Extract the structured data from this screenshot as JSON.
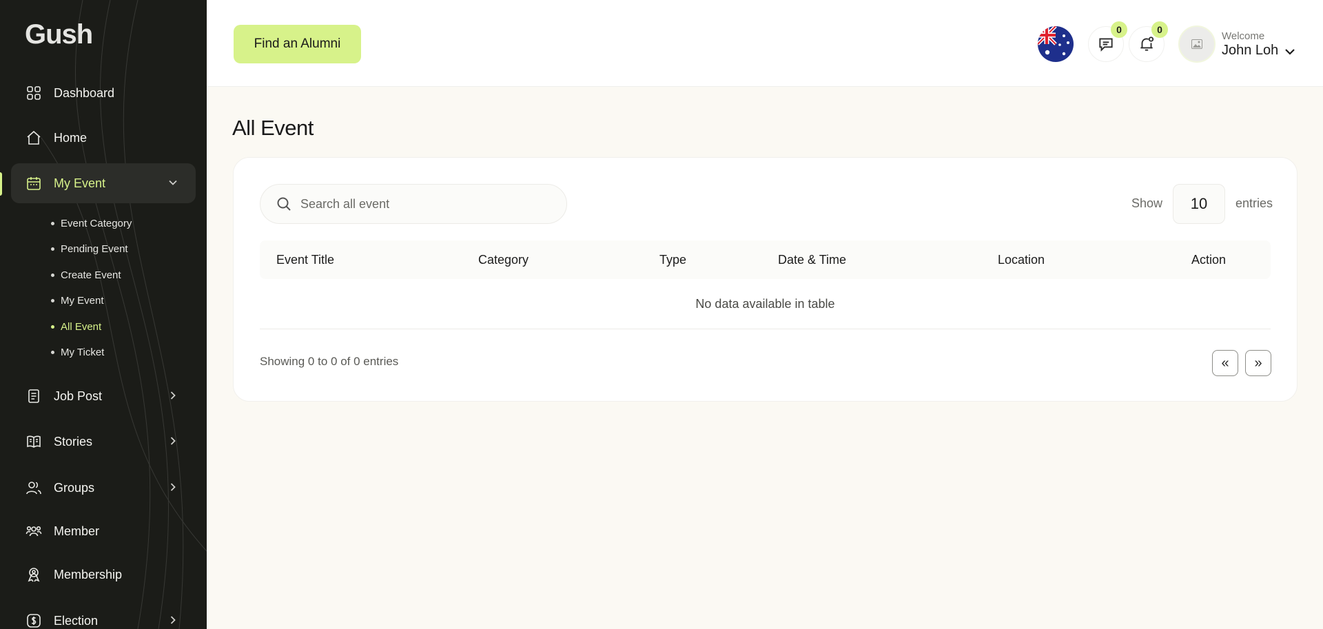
{
  "brand": {
    "logo_text": "Gush"
  },
  "sidebar": {
    "items": [
      {
        "label": "Dashboard",
        "icon": "dashboard-grid-icon"
      },
      {
        "label": "Home",
        "icon": "home-icon"
      },
      {
        "label": "My Event",
        "icon": "calendar-icon",
        "expanded": true
      },
      {
        "label": "Job Post",
        "icon": "document-icon"
      },
      {
        "label": "Stories",
        "icon": "book-icon"
      },
      {
        "label": "Groups",
        "icon": "users-icon"
      },
      {
        "label": "Member",
        "icon": "members-icon"
      },
      {
        "label": "Membership",
        "icon": "membership-badge-icon"
      },
      {
        "label": "Election",
        "icon": "dollar-icon"
      }
    ],
    "sub_items": [
      {
        "label": "Event Category"
      },
      {
        "label": "Pending Event"
      },
      {
        "label": "Create Event"
      },
      {
        "label": "My Event"
      },
      {
        "label": "All Event",
        "active": true
      },
      {
        "label": "My Ticket"
      }
    ]
  },
  "header": {
    "find_button": "Find an Alumni",
    "messages_count": "0",
    "notifications_count": "0",
    "welcome": "Welcome",
    "user_name": "John Loh",
    "language_flag": "australia-flag"
  },
  "main": {
    "title": "All Event",
    "search_placeholder": "Search all event",
    "show_label": "Show",
    "page_size": "10",
    "entries_label": "entries",
    "columns": [
      "Event Title",
      "Category",
      "Type",
      "Date & Time",
      "Location",
      "Action"
    ],
    "empty_message": "No data available in table",
    "showing_text": "Showing 0 to 0 of 0 entries",
    "pager": {
      "prev": "«",
      "next": "»"
    }
  },
  "colors": {
    "accent": "#d7f28a",
    "sidebar_bg": "#1b1c18",
    "page_bg": "#fbf9f3"
  }
}
